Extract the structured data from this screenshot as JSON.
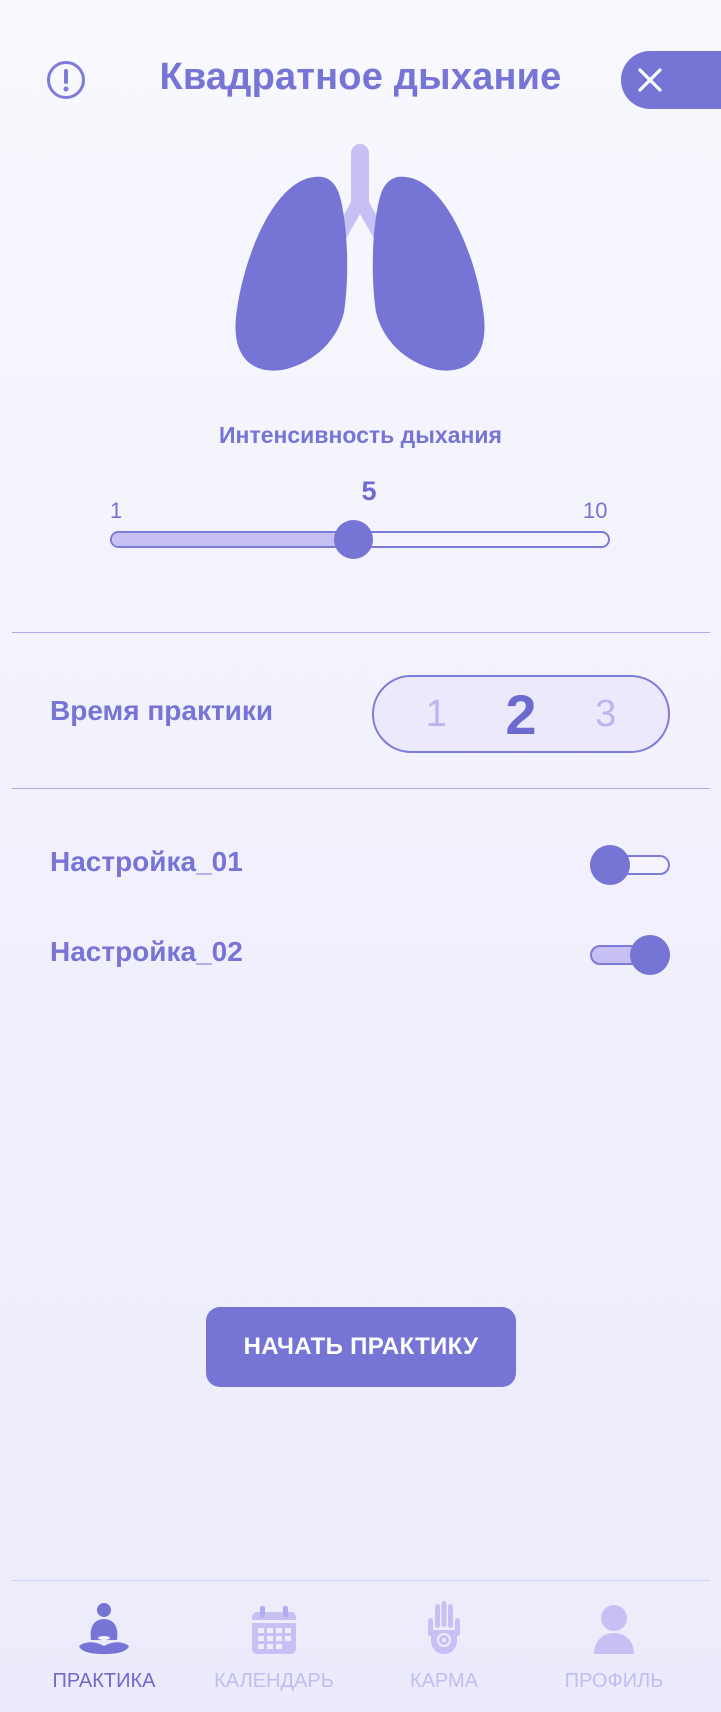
{
  "header": {
    "title": "Квадратное дыхание",
    "info_icon": "exclamation-icon",
    "close_icon": "close-icon"
  },
  "intensity": {
    "label": "Интенсивность дыхания",
    "min_label": "1",
    "max_label": "10",
    "value_label": "5",
    "value": 5,
    "min": 1,
    "max": 10
  },
  "practice_time": {
    "label": "Время практики",
    "options": [
      "1",
      "2",
      "3"
    ],
    "selected": "2"
  },
  "settings": [
    {
      "label": "Настройка_01",
      "on": false
    },
    {
      "label": "Настройка_02",
      "on": true
    }
  ],
  "start_button": {
    "label": "НАЧАТЬ ПРАКТИКУ"
  },
  "nav": [
    {
      "label": "ПРАКТИКА",
      "icon": "meditation-icon",
      "active": true
    },
    {
      "label": "КАЛЕНДАРЬ",
      "icon": "calendar-icon",
      "active": false
    },
    {
      "label": "КАРМА",
      "icon": "hamsa-hand-icon",
      "active": false
    },
    {
      "label": "ПРОФИЛЬ",
      "icon": "user-icon",
      "active": false
    }
  ],
  "colors": {
    "accent": "#7674d4",
    "accent_light": "#c6c0f5",
    "background": "#f4f3fd"
  }
}
